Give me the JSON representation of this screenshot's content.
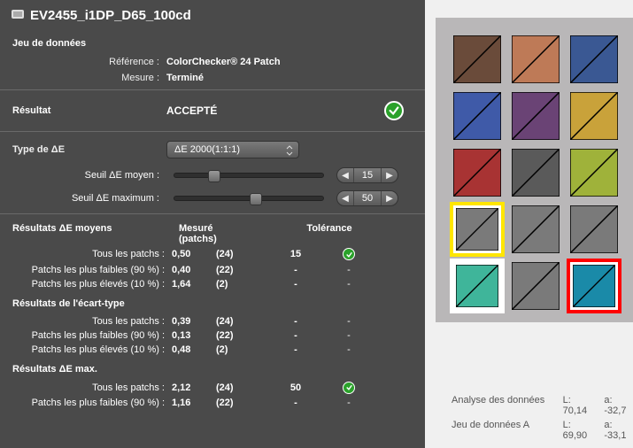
{
  "title": "EV2455_i1DP_D65_100cd",
  "sections": {
    "dataset": "Jeu de données",
    "reference_label": "Référence :",
    "reference_value": "ColorChecker® 24 Patch",
    "measure_label": "Mesure :",
    "measure_value": "Terminé",
    "result_label": "Résultat",
    "result_value": "ACCEPTÉ",
    "de_type_label": "Type de ΔE",
    "de_type_value": "ΔE 2000(1:1:1)",
    "threshold_mean_label": "Seuil ΔE moyen :",
    "threshold_mean_value": "15",
    "threshold_max_label": "Seuil ΔE maximum :",
    "threshold_max_value": "50"
  },
  "tables": {
    "mean_header": "Résultats ΔE moyens",
    "col_measured": "Mesuré (patchs)",
    "col_tolerance": "Tolérance",
    "mean_rows": [
      {
        "label": "Tous les patchs :",
        "val": "0,50",
        "count": "(24)",
        "tol": "15",
        "ok": true
      },
      {
        "label": "Patchs les plus faibles (90 %) :",
        "val": "0,40",
        "count": "(22)",
        "tol": "-",
        "ok": false
      },
      {
        "label": "Patchs les plus élevés (10 %) :",
        "val": "1,64",
        "count": "(2)",
        "tol": "-",
        "ok": false
      }
    ],
    "std_header": "Résultats de l'écart-type",
    "std_rows": [
      {
        "label": "Tous les patchs :",
        "val": "0,39",
        "count": "(24)",
        "tol": "-",
        "ok": false
      },
      {
        "label": "Patchs les plus faibles (90 %) :",
        "val": "0,13",
        "count": "(22)",
        "tol": "-",
        "ok": false
      },
      {
        "label": "Patchs les plus élevés (10 %) :",
        "val": "0,48",
        "count": "(2)",
        "tol": "-",
        "ok": false
      }
    ],
    "max_header": "Résultats ΔE max.",
    "max_rows": [
      {
        "label": "Tous les patchs :",
        "val": "2,12",
        "count": "(24)",
        "tol": "50",
        "ok": true
      },
      {
        "label": "Patchs les plus faibles (90 %) :",
        "val": "1,16",
        "count": "(22)",
        "tol": "-",
        "ok": false
      }
    ]
  },
  "swatches": [
    [
      {
        "c": "#6a4b3a"
      },
      {
        "c": "#be7a57"
      },
      {
        "c": "#3a5893"
      }
    ],
    [
      {
        "c": "#3f5aa8"
      },
      {
        "c": "#6a4375"
      },
      {
        "c": "#c9a23a"
      }
    ],
    [
      {
        "c": "#a83333"
      },
      {
        "c": "#5a5a5a"
      },
      {
        "c": "#9fb23a"
      }
    ],
    [
      {
        "c": "#7a7a7a",
        "sel": "y"
      },
      {
        "c": "#7a7a7a"
      },
      {
        "c": "#7a7a7a"
      }
    ],
    [
      {
        "c": "#3fb59a",
        "sel": "w"
      },
      {
        "c": "#7a7a7a"
      },
      {
        "c": "#1a8aa8",
        "sel": "r"
      }
    ]
  ],
  "analysis": {
    "row1_label": "Analyse des données",
    "row1_L": "L: 70,14",
    "row1_a": "a: -32,7",
    "row2_label": "Jeu de données A",
    "row2_L": "L: 69,90",
    "row2_a": "a: -33,1"
  }
}
